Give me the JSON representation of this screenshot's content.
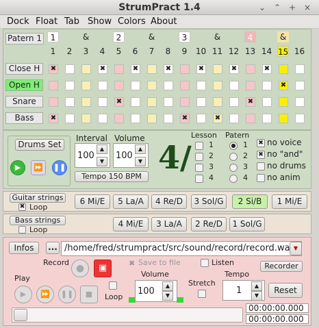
{
  "window": {
    "title": "StrumPract 1.4",
    "controls": [
      "⌄",
      "⌃",
      "+",
      "×"
    ]
  },
  "menu": [
    "Dock",
    "Float",
    "Tab",
    "Show",
    "Colors",
    "About"
  ],
  "pattern": {
    "label": "Patern 1",
    "beats": [
      "1",
      "&",
      "2",
      "&",
      "3",
      "&",
      "4",
      "&"
    ],
    "steps": [
      "1",
      "2",
      "3",
      "4",
      "5",
      "6",
      "7",
      "8",
      "9",
      "10",
      "11",
      "12",
      "13",
      "14",
      "15",
      "16"
    ],
    "rows": [
      {
        "label": "Close H",
        "marks": "x..x.x.x.x.x.x..",
        "colors": "r.y.r.y.r.y.r.b."
      },
      {
        "label": "Open H",
        "marks": "..............x.",
        "colors": "r.y.r.y.r.y.r.b."
      },
      {
        "label": "Snare",
        "marks": "....x.......x...",
        "colors": "r.y.r.y.r.y.r.b."
      },
      {
        "label": "Bass",
        "marks": "x.......x.x.....",
        "colors": "r.y.r.y.r.y.r.b."
      }
    ]
  },
  "controls": {
    "drums_set": "Drums Set",
    "interval_label": "Interval",
    "interval_value": "100",
    "volume_label": "Volume",
    "volume_value": "100",
    "tempo": "Tempo 150 BPM",
    "time_signature": "4/",
    "lesson_label": "Lesson",
    "lesson_options": [
      "1",
      "2",
      "3",
      "4"
    ],
    "patern_label": "Patern",
    "patern_options": [
      "1",
      "2",
      "3",
      "4"
    ],
    "patern_selected": "1",
    "flags": [
      {
        "label": "no voice",
        "checked": true
      },
      {
        "label": "no \"and\"",
        "checked": true
      },
      {
        "label": "no drums",
        "checked": false
      },
      {
        "label": "no anim",
        "checked": false
      }
    ]
  },
  "guitar": {
    "label": "Guitar strings",
    "loop": "Loop",
    "loop_checked": true,
    "strings": [
      "6 Mi/E",
      "5 La/A",
      "4 Re/D",
      "3 Sol/G",
      "2 Si/B",
      "1 Mi/E"
    ],
    "active": "2 Si/B"
  },
  "bass": {
    "label": "Bass strings",
    "loop": "Loop",
    "strings": [
      "4 Mi/E",
      "3 La/A",
      "2 Re/D",
      "1 Sol/G"
    ]
  },
  "recorder": {
    "infos": "Infos",
    "browse": "...",
    "path": "/home/fred/strumpract/src/sound/record/record.wav",
    "record_label": "Record",
    "save_to_file": "Save to file",
    "listen": "Listen",
    "recorder_btn": "Recorder",
    "play_label": "Play",
    "loop_label": "Loop",
    "volume_label": "Volume",
    "volume_value": "100",
    "stretch_label": "Stretch",
    "tempo_label": "Tempo",
    "tempo_value": "1",
    "reset": "Reset",
    "time1": "00:00:00.000",
    "time2": "00:00:00.000"
  },
  "colors": {
    "cell_red": "#f5c6c6",
    "cell_yellow": "#f8efb4",
    "cell_bright": "#f8f000",
    "open_h_label": "#7cf070",
    "active_string": "#c7f0a8"
  }
}
